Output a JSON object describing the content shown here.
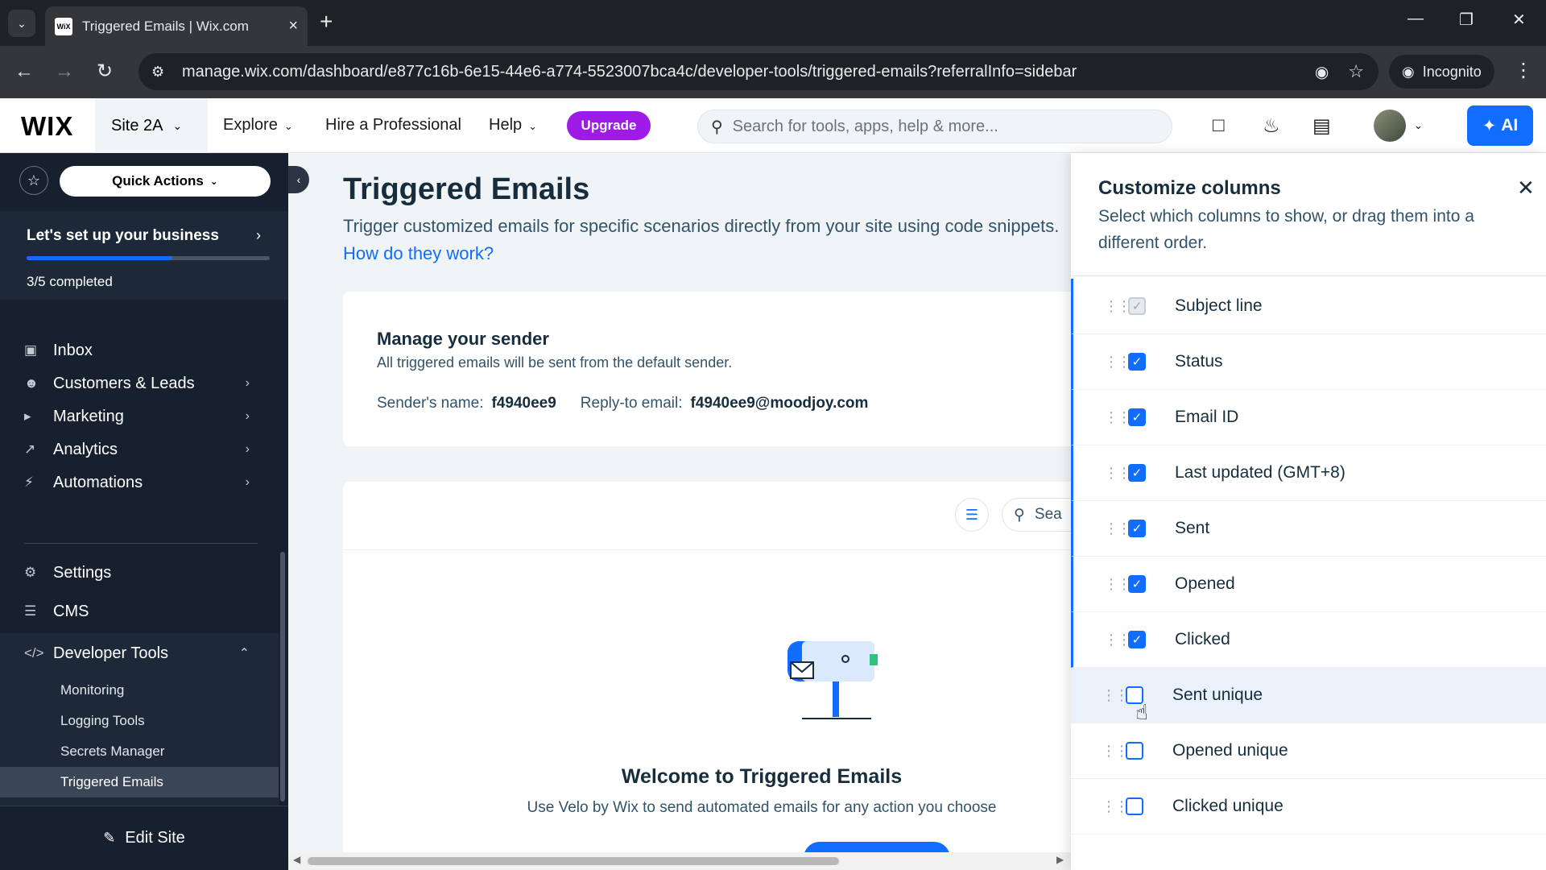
{
  "browser": {
    "tab_title": "Triggered Emails | Wix.com",
    "favicon_text": "WiX",
    "url": "manage.wix.com/dashboard/e877c16b-6e15-44e6-a774-5523007bca4c/developer-tools/triggered-emails?referralInfo=sidebar",
    "incognito_label": "Incognito"
  },
  "header": {
    "logo": "WIX",
    "site_name": "Site 2A",
    "nav": {
      "explore": "Explore",
      "hire": "Hire a Professional",
      "help": "Help"
    },
    "upgrade_label": "Upgrade",
    "search_placeholder": "Search for tools, apps, help & more...",
    "ai_label": "AI"
  },
  "sidebar": {
    "quick_actions": "Quick Actions",
    "setup": {
      "title": "Let's set up your business",
      "progress_text": "3/5 completed",
      "progress": 0.6
    },
    "items": {
      "inbox": "Inbox",
      "customers": "Customers & Leads",
      "marketing": "Marketing",
      "analytics": "Analytics",
      "automations": "Automations",
      "settings": "Settings",
      "cms": "CMS",
      "developer_tools": "Developer Tools"
    },
    "dev_sub": {
      "monitoring": "Monitoring",
      "logging": "Logging Tools",
      "secrets": "Secrets Manager",
      "triggered": "Triggered Emails"
    },
    "edit_site": "Edit Site"
  },
  "main": {
    "title": "Triggered Emails",
    "description": "Trigger customized emails for specific scenarios directly from your site using code snippets.",
    "how_link": "How do they work?",
    "sender": {
      "title": "Manage your sender",
      "subtitle": "All triggered emails will be sent from the default sender.",
      "name_label": "Sender's name:",
      "name_value": "f4940ee9",
      "reply_label": "Reply-to email:",
      "reply_value": "f4940ee9@moodjoy.com"
    },
    "list_search_placeholder": "Sea",
    "welcome_title": "Welcome to Triggered Emails",
    "welcome_sub": "Use Velo by Wix to send automated emails for any action you choose"
  },
  "panel": {
    "title": "Customize columns",
    "subtitle": "Select which columns to show, or drag them into a different order.",
    "columns": [
      {
        "label": "Subject line",
        "checked": true
      },
      {
        "label": "Status",
        "checked": true
      },
      {
        "label": "Email ID",
        "checked": true
      },
      {
        "label": "Last updated (GMT+8)",
        "checked": true
      },
      {
        "label": "Sent",
        "checked": true
      },
      {
        "label": "Opened",
        "checked": true
      },
      {
        "label": "Clicked",
        "checked": true
      },
      {
        "label": "Sent unique",
        "checked": false
      },
      {
        "label": "Opened unique",
        "checked": false
      },
      {
        "label": "Clicked unique",
        "checked": false
      }
    ]
  },
  "colors": {
    "accent": "#116dff",
    "upgrade": "#9d1ae7",
    "sidebar": "#16202e"
  }
}
